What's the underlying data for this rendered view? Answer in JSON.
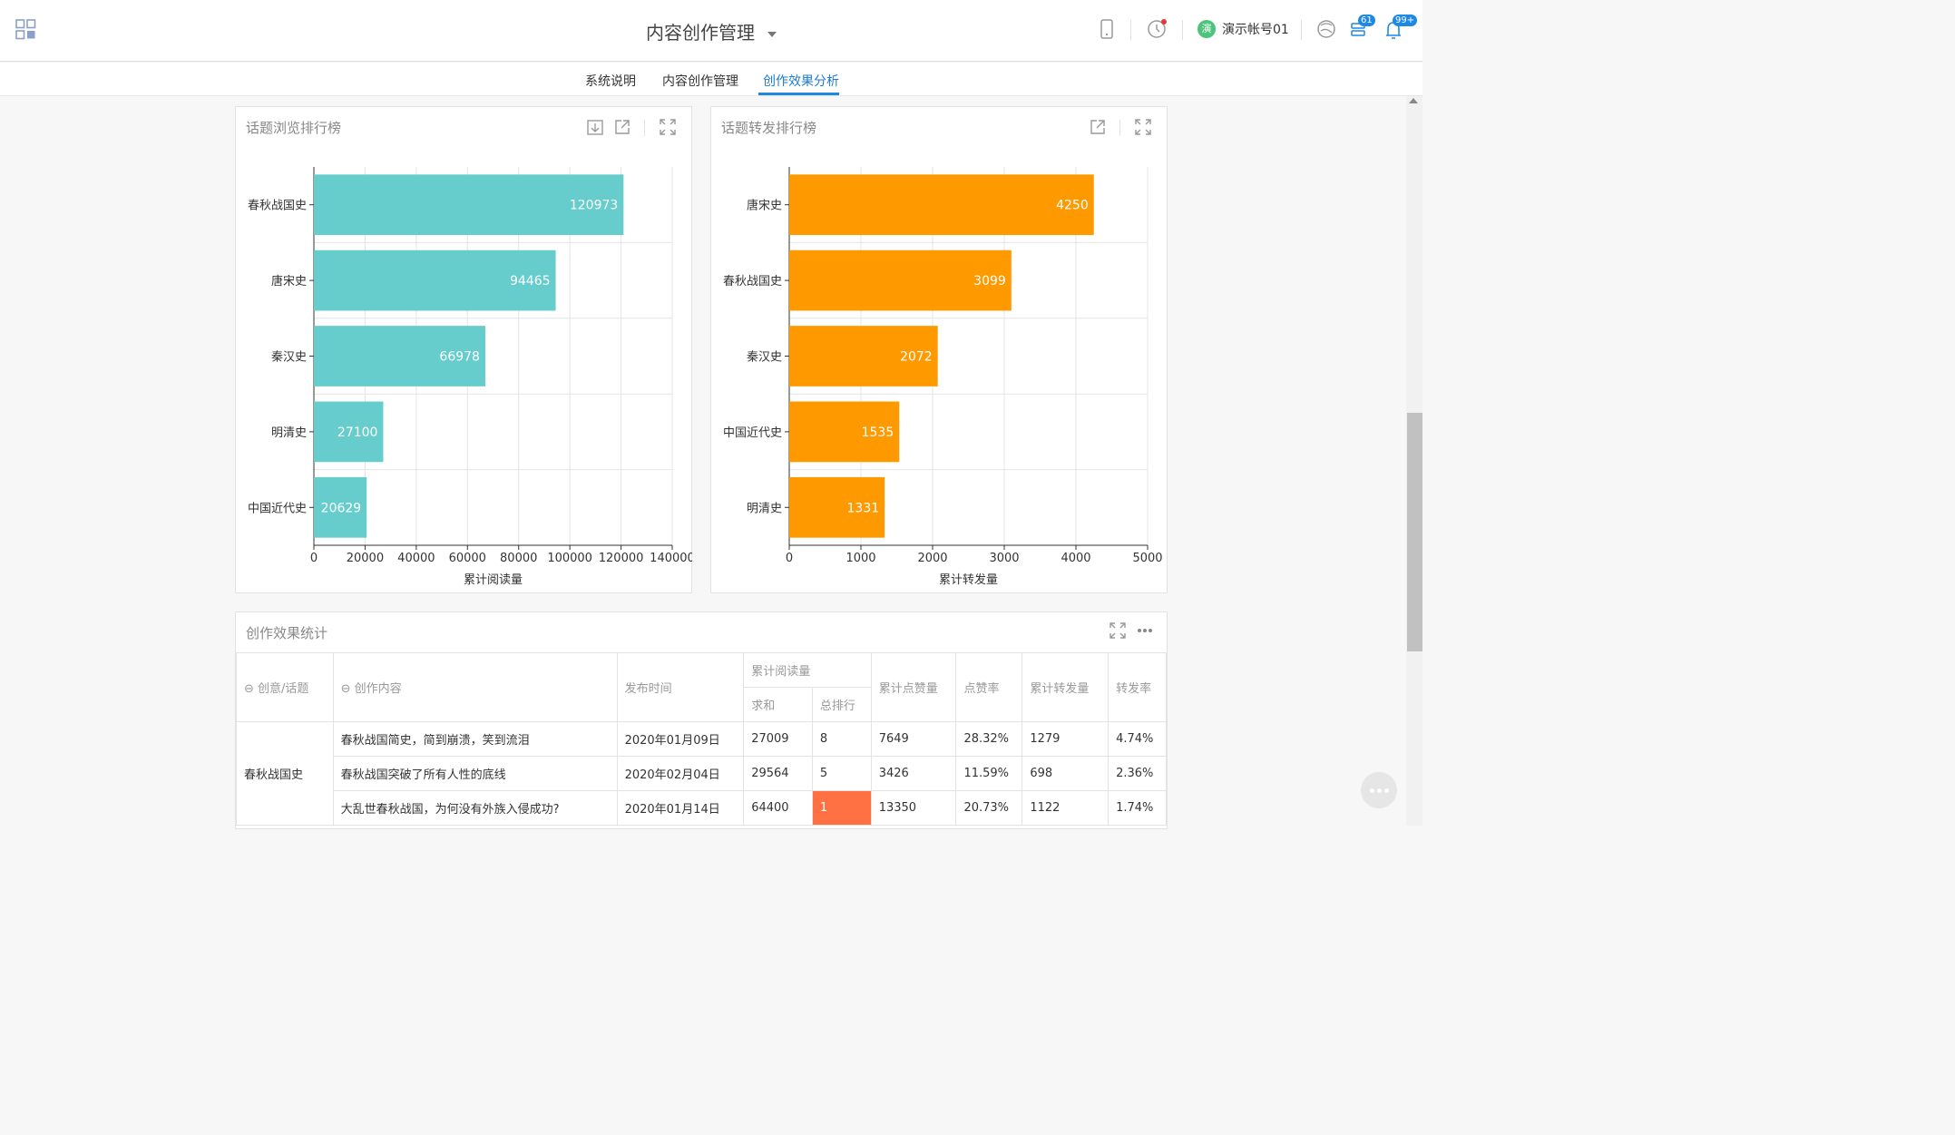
{
  "header": {
    "app_title": "内容创作管理",
    "account_avatar": "演",
    "account_name": "演示帐号01",
    "task_badge": "61",
    "notify_badge": "99+",
    "brand_color": "#1e88e5"
  },
  "subnav": {
    "tabs": [
      {
        "label": "系统说明"
      },
      {
        "label": "内容创作管理"
      },
      {
        "label": "创作效果分析"
      }
    ],
    "active": "创作效果分析"
  },
  "chart_data": [
    {
      "type": "bar",
      "orientation": "horizontal",
      "title": "话题浏览排行榜",
      "categories": [
        "春秋战国史",
        "唐宋史",
        "秦汉史",
        "明清史",
        "中国近代史"
      ],
      "values": [
        120973,
        94465,
        66978,
        27100,
        20629
      ],
      "xlabel": "累计阅读量",
      "ylabel": "",
      "xlim": [
        0,
        140000
      ],
      "xticks": [
        "0",
        "20000",
        "40000",
        "60000",
        "80000",
        "100000",
        "120000",
        "140000"
      ],
      "color": "#66cdcc",
      "grid": true
    },
    {
      "type": "bar",
      "orientation": "horizontal",
      "title": "话题转发排行榜",
      "categories": [
        "唐宋史",
        "春秋战国史",
        "秦汉史",
        "中国近代史",
        "明清史"
      ],
      "values": [
        4250,
        3099,
        2072,
        1535,
        1331
      ],
      "xlabel": "累计转发量",
      "ylabel": "",
      "xlim": [
        0,
        5000
      ],
      "xticks": [
        "0",
        "1000",
        "2000",
        "3000",
        "4000",
        "5000"
      ],
      "color": "#ff9900",
      "grid": true
    }
  ],
  "stats": {
    "title": "创作效果统计",
    "headers": {
      "topic": "⊖ 创意/话题",
      "content": "⊖ 创作内容",
      "date": "发布时间",
      "reads": "累计阅读量",
      "reads_sum": "求和",
      "reads_rank": "总排行",
      "likes": "累计点赞量",
      "like_rate": "点赞率",
      "forwards": "累计转发量",
      "forward_rate": "转发率"
    },
    "group": "春秋战国史",
    "rows": [
      {
        "content": "春秋战国简史，简到崩溃，笑到流泪",
        "date": "2020年01月09日",
        "sum": "27009",
        "rank": "8",
        "likes": "7649",
        "like_rate": "28.32%",
        "forwards": "1279",
        "forward_rate": "4.74%"
      },
      {
        "content": "春秋战国突破了所有人性的底线",
        "date": "2020年02月04日",
        "sum": "29564",
        "rank": "5",
        "likes": "3426",
        "like_rate": "11.59%",
        "forwards": "698",
        "forward_rate": "2.36%"
      },
      {
        "content": "大乱世春秋战国，为何没有外族入侵成功?",
        "date": "2020年01月14日",
        "sum": "64400",
        "rank": "1",
        "likes": "13350",
        "like_rate": "20.73%",
        "forwards": "1122",
        "forward_rate": "1.74%"
      }
    ],
    "highlight_color": "#ff7043"
  }
}
